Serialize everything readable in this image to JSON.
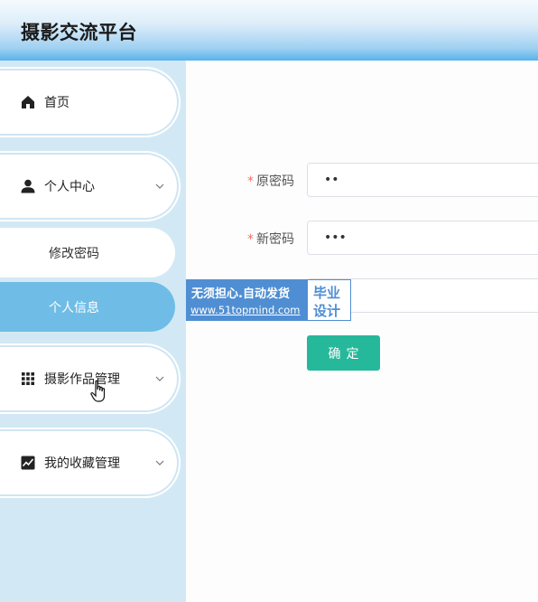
{
  "app": {
    "title": "摄影交流平台"
  },
  "sidebar": {
    "items": [
      {
        "label": "首页",
        "icon": "home-icon"
      },
      {
        "label": "个人中心",
        "icon": "user-icon",
        "expanded": true,
        "children": [
          {
            "label": "修改密码"
          },
          {
            "label": "个人信息",
            "active": true
          }
        ]
      },
      {
        "label": "摄影作品管理",
        "icon": "grid-icon"
      },
      {
        "label": "我的收藏管理",
        "icon": "chart-icon"
      }
    ]
  },
  "form": {
    "old_password": {
      "label": "原密码",
      "value": "••"
    },
    "new_password": {
      "label": "新密码",
      "value": "•••"
    },
    "confirm_password": {
      "value": ""
    },
    "confirm_button": "确定"
  },
  "watermark": {
    "line1": "无须担心.自动发货",
    "line2": "www.51topmind.com",
    "right1": "毕业",
    "right2": "设计"
  },
  "colors": {
    "active": "#6fbde6",
    "button": "#26b89a",
    "required": "#f56c6c",
    "sidebar_bg": "#d2e9f5"
  }
}
